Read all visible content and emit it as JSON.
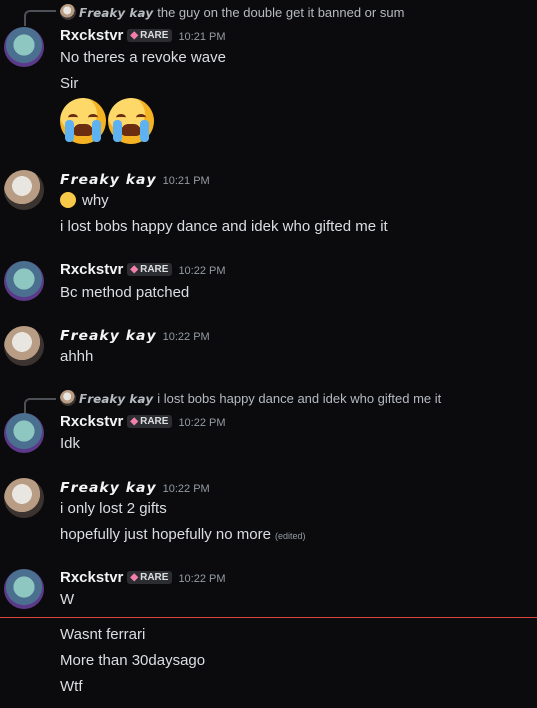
{
  "messages": [
    {
      "reply": {
        "name": "𝙁𝙧𝙚𝙖𝙠𝙮 𝙠𝙖𝙮",
        "text": "the guy on the double get it banned or sum"
      },
      "author": "Rxckstvr",
      "badge": "RARE",
      "time": "10:21 PM",
      "lines": [
        "No theres a revoke wave",
        "Sir"
      ]
    },
    {
      "author": "𝙁𝙧𝙚𝙖𝙠𝙮 𝙠𝙖𝙮",
      "time": "10:21 PM",
      "lines": [
        "why",
        "i lost bobs happy dance and idek who gifted me it"
      ]
    },
    {
      "author": "Rxckstvr",
      "badge": "RARE",
      "time": "10:22 PM",
      "lines": [
        "Bc method patched"
      ]
    },
    {
      "author": "𝙁𝙧𝙚𝙖𝙠𝙮 𝙠𝙖𝙮",
      "time": "10:22 PM",
      "lines": [
        "ahhh"
      ]
    },
    {
      "reply": {
        "name": "𝙁𝙧𝙚𝙖𝙠𝙮 𝙠𝙖𝙮",
        "text": "i lost bobs happy dance and idek who gifted me it"
      },
      "author": "Rxckstvr",
      "badge": "RARE",
      "time": "10:22 PM",
      "lines": [
        "Idk"
      ]
    },
    {
      "author": "𝙁𝙧𝙚𝙖𝙠𝙮 𝙠𝙖𝙮",
      "time": "10:22 PM",
      "lines": [
        "i only lost 2 gifts",
        "hopefully just hopefully no more"
      ],
      "edited": "(edited)"
    },
    {
      "author": "Rxckstvr",
      "badge": "RARE",
      "time": "10:22 PM",
      "lines": [
        "W",
        "Wasnt ferrari",
        "More than 30daysago",
        "Wtf"
      ]
    }
  ],
  "icons": {
    "badge": "gem-icon",
    "reaction": "loudly-crying-face-emoji",
    "small": "face-emoji"
  }
}
